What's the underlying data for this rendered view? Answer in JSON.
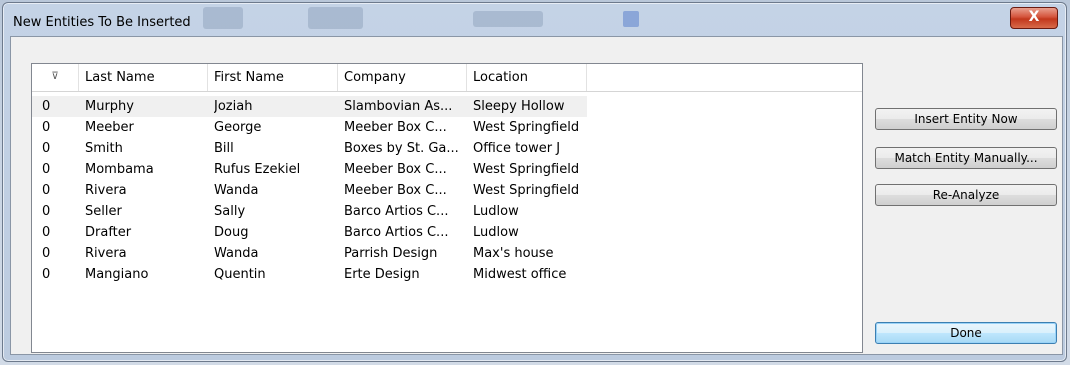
{
  "window": {
    "title": "New Entities To Be Inserted",
    "close_glyph": "X"
  },
  "grid": {
    "sort_glyph": "⊽",
    "columns": [
      "Last Name",
      "First Name",
      "Company",
      "Location"
    ],
    "rows": [
      {
        "flag": "0",
        "last": "Murphy",
        "first": "Joziah",
        "company": "Slambovian As...",
        "location": "Sleepy Hollow"
      },
      {
        "flag": "0",
        "last": "Meeber",
        "first": "George",
        "company": "Meeber Box C...",
        "location": "West Springfield"
      },
      {
        "flag": "0",
        "last": "Smith",
        "first": "Bill",
        "company": "Boxes by St. Ga...",
        "location": "Office tower J"
      },
      {
        "flag": "0",
        "last": "Mombama",
        "first": "Rufus Ezekiel",
        "company": "Meeber Box C...",
        "location": "West Springfield"
      },
      {
        "flag": "0",
        "last": "Rivera",
        "first": "Wanda",
        "company": "Meeber Box C...",
        "location": "West Springfield"
      },
      {
        "flag": "0",
        "last": "Seller",
        "first": "Sally",
        "company": "Barco Artios C...",
        "location": "Ludlow"
      },
      {
        "flag": "0",
        "last": "Drafter",
        "first": "Doug",
        "company": "Barco Artios C...",
        "location": "Ludlow"
      },
      {
        "flag": "0",
        "last": "Rivera",
        "first": "Wanda",
        "company": "Parrish Design",
        "location": "Max's house"
      },
      {
        "flag": "0",
        "last": "Mangiano",
        "first": "Quentin",
        "company": "Erte Design",
        "location": "Midwest office"
      }
    ]
  },
  "buttons": {
    "insert": "Insert Entity Now",
    "match": "Match Entity Manually...",
    "reanalyze": "Re-Analyze",
    "done": "Done"
  }
}
